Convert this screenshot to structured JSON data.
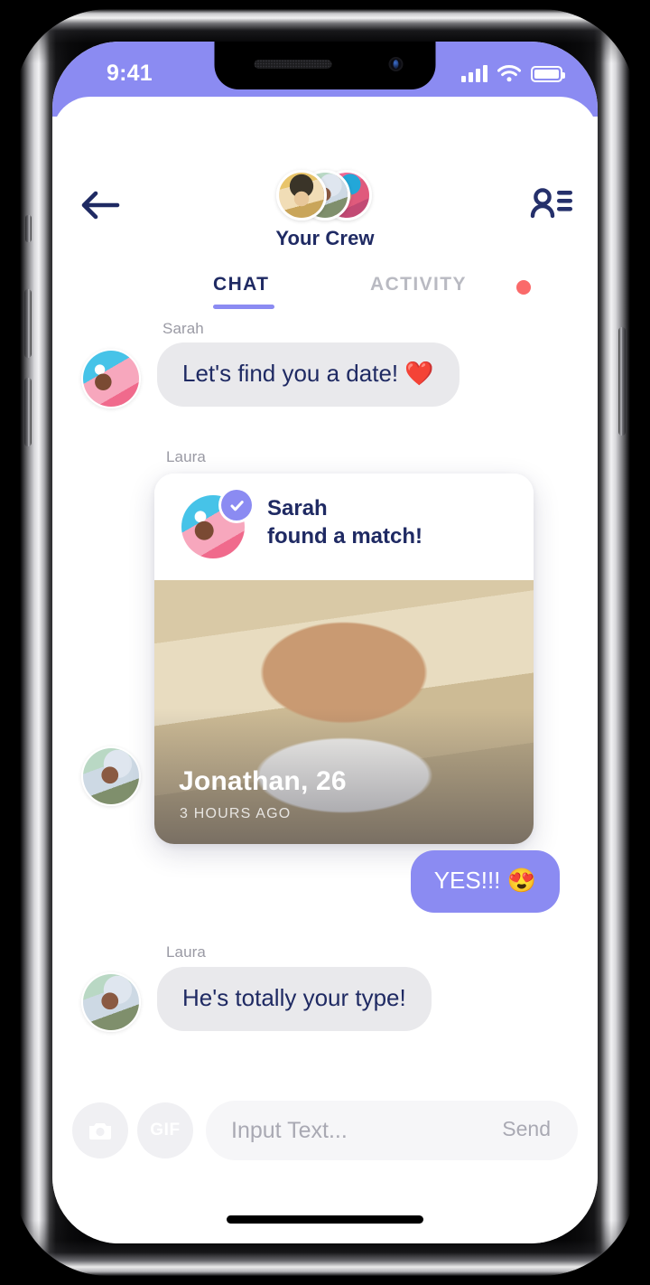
{
  "status_bar": {
    "time": "9:41",
    "signal_icon": "cellular-signal-icon",
    "wifi_icon": "wifi-icon",
    "battery_icon": "battery-icon"
  },
  "header": {
    "back_icon": "back-arrow-icon",
    "contacts_icon": "contact-list-icon",
    "title": "Your Crew",
    "avatars": [
      {
        "name": "crew-avatar-1",
        "style": "ph-blonde"
      },
      {
        "name": "crew-avatar-2",
        "style": "ph-laura"
      },
      {
        "name": "crew-avatar-3",
        "style": "ph-redhead"
      }
    ]
  },
  "tabs": {
    "chat_label": "CHAT",
    "activity_label": "ACTIVITY",
    "active": "CHAT",
    "activity_has_badge": true
  },
  "messages": [
    {
      "sender": "Sarah",
      "type": "text",
      "direction": "incoming",
      "text": "Let's find you a date! ❤️"
    },
    {
      "sender": "Laura",
      "type": "match_card",
      "direction": "incoming",
      "card": {
        "title_line_1": "Sarah",
        "title_line_2": "found a match!",
        "verified": true,
        "match_name": "Jonathan, 26",
        "match_time": "3 HOURS AGO"
      }
    },
    {
      "sender": "",
      "type": "text",
      "direction": "outgoing",
      "text": "YES!!! 😍"
    },
    {
      "sender": "Laura",
      "type": "text",
      "direction": "incoming",
      "text": "He's totally your type!"
    }
  ],
  "input_bar": {
    "camera_icon": "camera-icon",
    "gif_label": "GIF",
    "placeholder": "Input Text...",
    "value": "",
    "send_label": "Send"
  },
  "colors": {
    "accent": "#8b8bf2",
    "navy": "#1f2a63",
    "alert": "#fa6a6a",
    "bubble_in": "#e9e9ec",
    "field": "#f6f6f8"
  }
}
